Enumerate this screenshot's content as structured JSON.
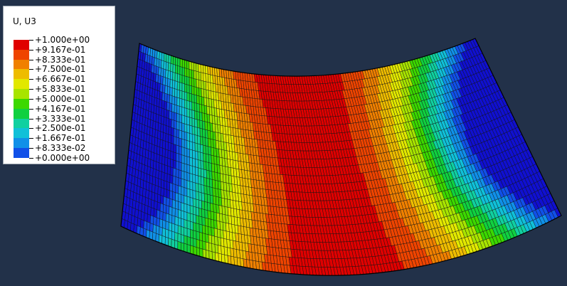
{
  "legend": {
    "title": "U, U3",
    "labels": [
      "+1.000e+00",
      "+9.167e-01",
      "+8.333e-01",
      "+7.500e-01",
      "+6.667e-01",
      "+5.833e-01",
      "+5.000e-01",
      "+4.167e-01",
      "+3.333e-01",
      "+2.500e-01",
      "+1.667e-01",
      "+8.333e-02",
      "+0.000e+00"
    ],
    "colors": [
      "#e00000",
      "#ef4400",
      "#f08000",
      "#eebc00",
      "#e2e800",
      "#a8e400",
      "#3cd800",
      "#10d040",
      "#10d0a0",
      "#10c0d8",
      "#1090e8",
      "#1050e8",
      "#1010d0"
    ]
  },
  "viewport": {
    "background": "#223149",
    "mesh_line_color": "#141414"
  }
}
